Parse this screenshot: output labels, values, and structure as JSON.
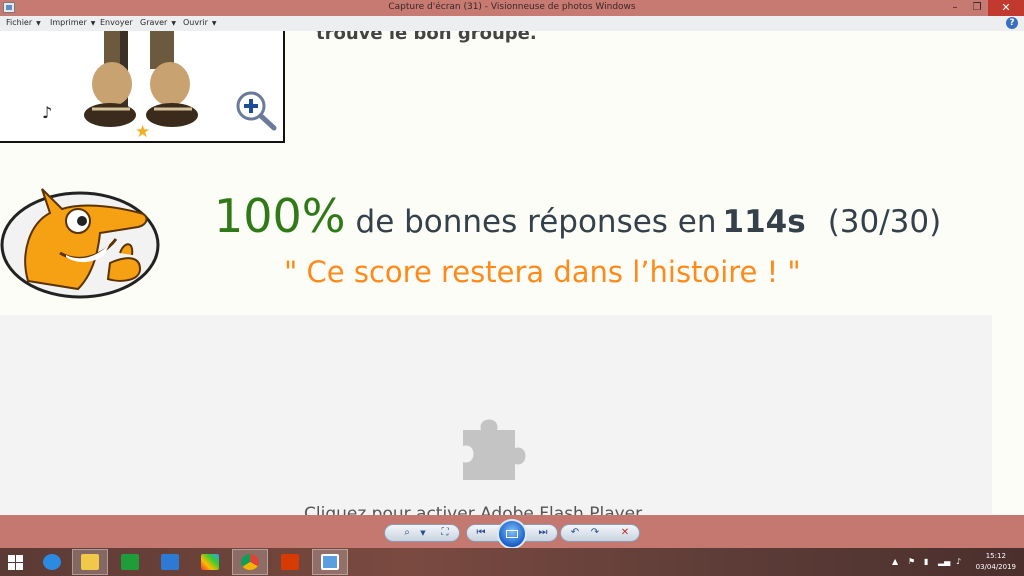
{
  "window": {
    "title": "Capture d'écran (31) - Visionneuse de photos Windows"
  },
  "menu": {
    "items": [
      {
        "label": "Fichier"
      },
      {
        "label": "Imprimer"
      },
      {
        "label": "Envoyer"
      },
      {
        "label": "Graver"
      },
      {
        "label": "Ouvrir"
      }
    ],
    "help": "?"
  },
  "content": {
    "intro_text": "trouve le bon groupe.",
    "score": {
      "percent": "100%",
      "middle": "de bonnes réponses en",
      "time": "114s",
      "ratio": "(30/30)"
    },
    "quote": "\" Ce score restera dans l’histoire ! \"",
    "flash_prompt": "Cliquez pour activer Adobe Flash Player"
  },
  "controls": {
    "icons": [
      "zoom-icon",
      "actual-size-icon",
      "previous-icon",
      "slideshow-icon",
      "next-icon",
      "rotate-left-icon",
      "rotate-right-icon",
      "delete-icon"
    ]
  },
  "taskbar": {
    "apps": [
      "internet-explorer",
      "file-explorer",
      "store",
      "dropbox",
      "photo-app",
      "chrome",
      "office",
      "photo-viewer"
    ],
    "time": "15:12",
    "date": "03/04/2019"
  },
  "colors": {
    "titlebar": "#c77a72",
    "score_green": "#2f7a17",
    "quote_orange": "#ff8a1a",
    "star": "#f0b020"
  }
}
